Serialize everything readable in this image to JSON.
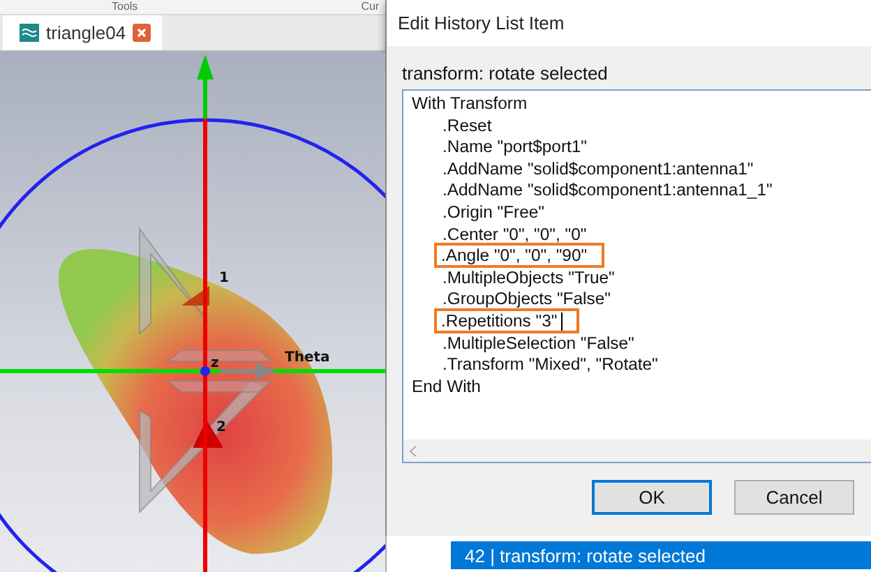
{
  "ribbon": {
    "groups": [
      "Tools",
      "Cur"
    ]
  },
  "tabs": [
    {
      "label": "triangle04",
      "selected": true
    }
  ],
  "viewport": {
    "labels": [
      {
        "kind": "port",
        "text": "1"
      },
      {
        "kind": "origin",
        "text": "z"
      },
      {
        "kind": "axis",
        "text": "Theta"
      },
      {
        "kind": "port",
        "text": "2"
      }
    ]
  },
  "dialog": {
    "title": "Edit History List Item",
    "caption": "transform: rotate selected",
    "lines": [
      {
        "kind": "block",
        "text": "With Transform",
        "highlighted": false,
        "caret": false
      },
      {
        "kind": "statement",
        "text": ".Reset",
        "highlighted": false,
        "caret": false
      },
      {
        "kind": "statement",
        "text": ".Name \"port$port1\"",
        "highlighted": false,
        "caret": false
      },
      {
        "kind": "statement",
        "text": ".AddName \"solid$component1:antenna1\"",
        "highlighted": false,
        "caret": false
      },
      {
        "kind": "statement",
        "text": ".AddName \"solid$component1:antenna1_1\"",
        "highlighted": false,
        "caret": false
      },
      {
        "kind": "statement",
        "text": ".Origin \"Free\"",
        "highlighted": false,
        "caret": false
      },
      {
        "kind": "statement",
        "text": ".Center \"0\", \"0\", \"0\"",
        "highlighted": false,
        "caret": false
      },
      {
        "kind": "statement",
        "text": ".Angle \"0\", \"0\", \"90\"",
        "highlighted": true,
        "caret": false
      },
      {
        "kind": "statement",
        "text": ".MultipleObjects \"True\"",
        "highlighted": false,
        "caret": false
      },
      {
        "kind": "statement",
        "text": ".GroupObjects \"False\"",
        "highlighted": false,
        "caret": false
      },
      {
        "kind": "statement",
        "text": ".Repetitions \"3\"",
        "highlighted": true,
        "caret": true
      },
      {
        "kind": "statement",
        "text": ".MultipleSelection \"False\"",
        "highlighted": false,
        "caret": false
      },
      {
        "kind": "statement",
        "text": ".Transform \"Mixed\", \"Rotate\"",
        "highlighted": false,
        "caret": false
      },
      {
        "kind": "block",
        "text": "End With",
        "highlighted": false,
        "caret": false
      }
    ],
    "buttons": [
      {
        "label": "OK",
        "default": true
      },
      {
        "label": "Cancel",
        "default": false
      }
    ]
  },
  "history": {
    "rows": [
      {
        "text": "42 | transform: rotate selected",
        "selected": true
      }
    ]
  }
}
